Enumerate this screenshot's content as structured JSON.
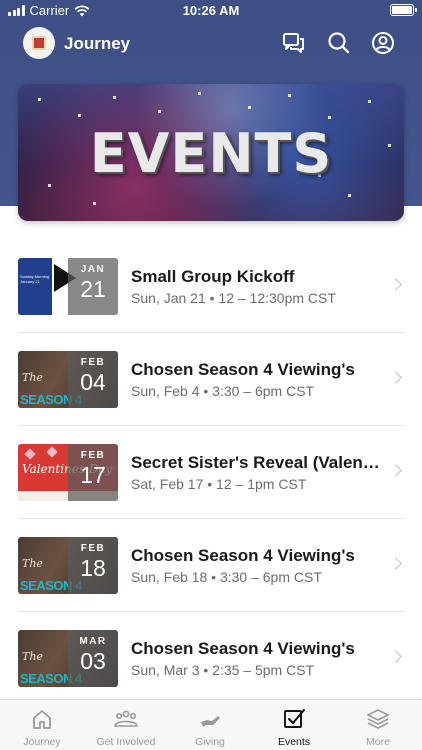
{
  "status_bar": {
    "carrier": "Carrier",
    "time": "10:26 AM"
  },
  "nav": {
    "title": "Journey",
    "icons": [
      "chat-bubbles-icon",
      "search-icon",
      "profile-icon"
    ]
  },
  "banner": {
    "title": "EVENTS"
  },
  "events": [
    {
      "title": "Small Group Kickoff",
      "subtitle": "Sun, Jan 21 • 12 – 12:30pm CST",
      "month": "JAN",
      "day": "21",
      "thumb": "kickoff",
      "thumb_text": "Sunday Morning January 21"
    },
    {
      "title": "Chosen Season 4 Viewing's",
      "subtitle": "Sun, Feb 4 • 3:30 – 6pm CST",
      "month": "FEB",
      "day": "04",
      "thumb": "chosen",
      "thumb_series": "The",
      "thumb_season": "SEASON 4"
    },
    {
      "title": "Secret Sister's Reveal (Valentine's Day)",
      "subtitle": "Sat, Feb 17 • 12 – 1pm CST",
      "month": "FEB",
      "day": "17",
      "thumb": "valentine",
      "thumb_text": "Valentines Day"
    },
    {
      "title": "Chosen Season 4 Viewing's",
      "subtitle": "Sun, Feb 18 • 3:30 – 6pm CST",
      "month": "FEB",
      "day": "18",
      "thumb": "chosen",
      "thumb_series": "The",
      "thumb_season": "SEASON 4"
    },
    {
      "title": "Chosen Season 4 Viewing's",
      "subtitle": "Sun, Mar 3 • 2:35 – 5pm CST",
      "month": "MAR",
      "day": "03",
      "thumb": "chosen",
      "thumb_series": "The",
      "thumb_season": "SEASON 4"
    }
  ],
  "tabs": [
    {
      "label": "Journey",
      "icon": "home-icon",
      "active": false
    },
    {
      "label": "Get Involved",
      "icon": "group-icon",
      "active": false
    },
    {
      "label": "Giving",
      "icon": "giving-hand-icon",
      "active": false
    },
    {
      "label": "Events",
      "icon": "checklist-icon",
      "active": true
    },
    {
      "label": "More",
      "icon": "layers-icon",
      "active": false
    }
  ],
  "colors": {
    "header": "#3e4f86",
    "tab_active": "#111111",
    "tab_inactive": "#9a9a9a"
  }
}
